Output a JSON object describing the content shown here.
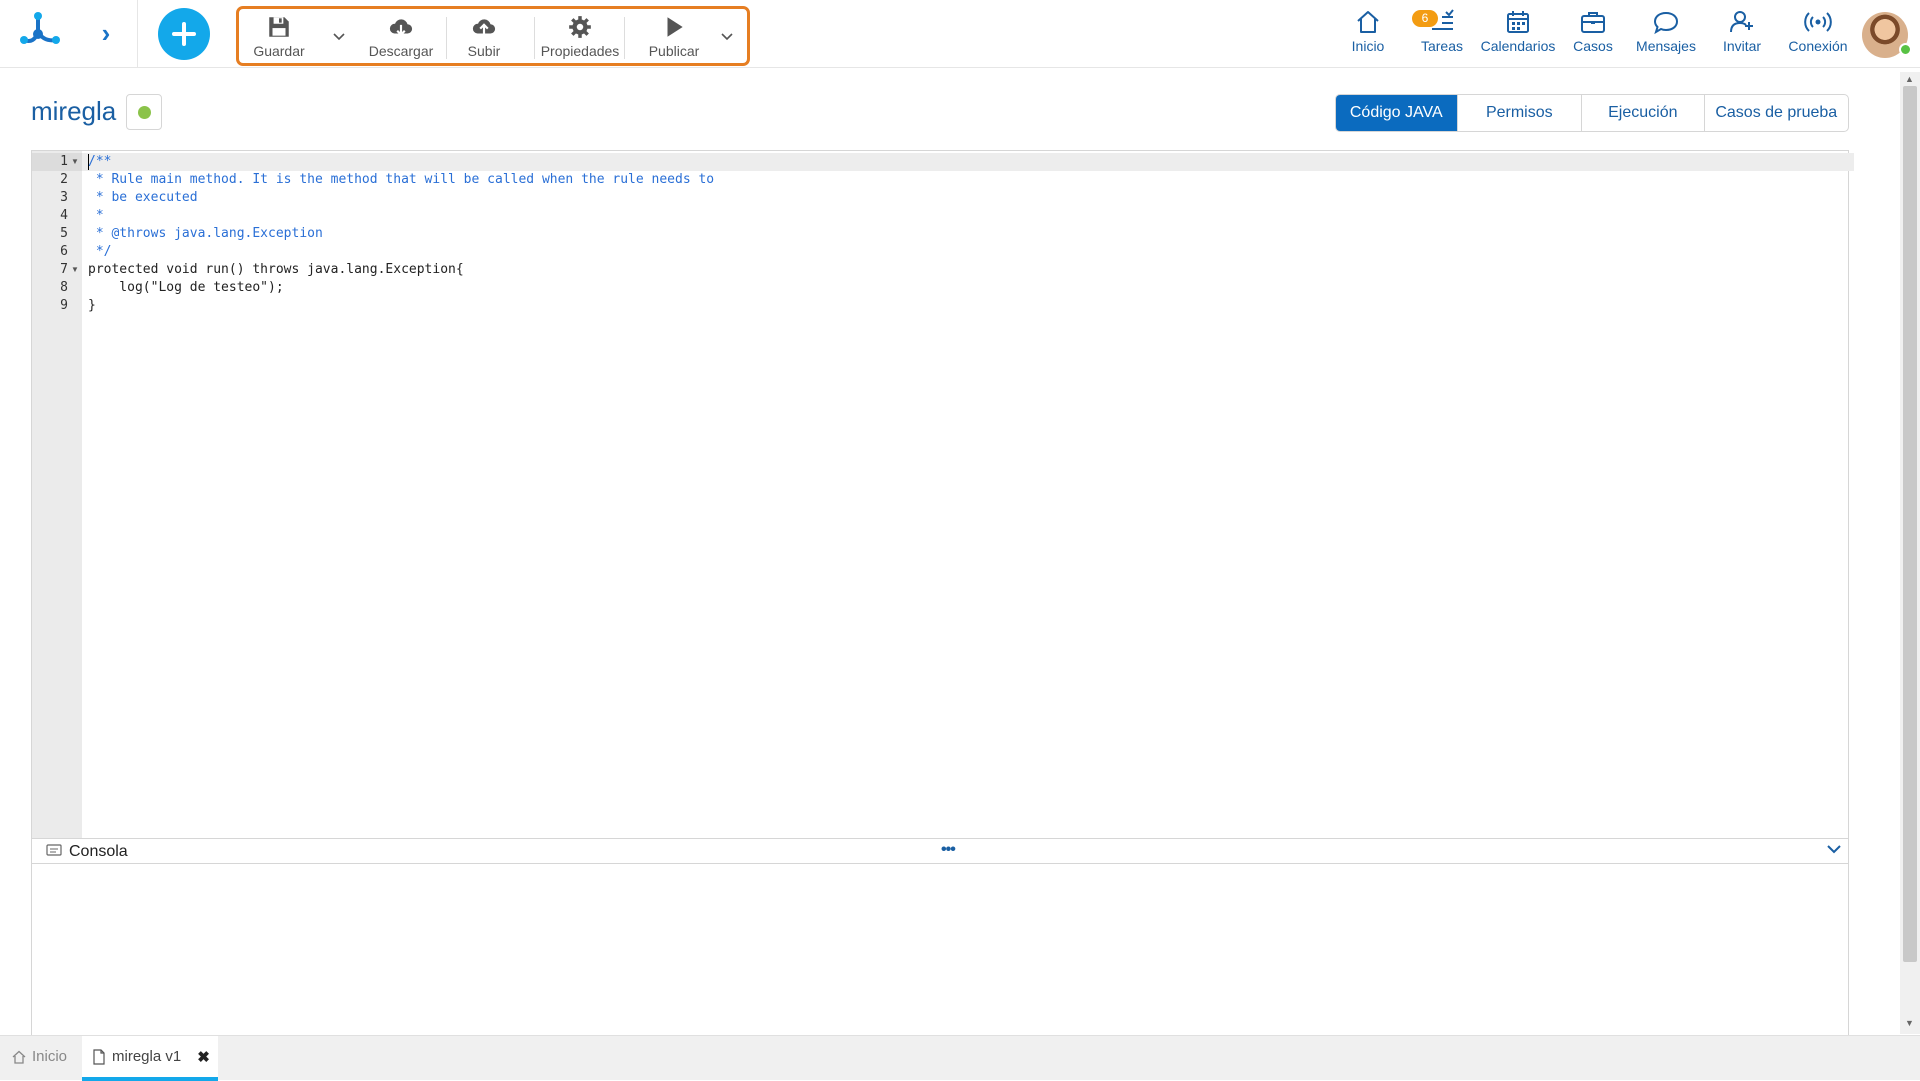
{
  "header": {
    "toolbar": {
      "save_label": "Guardar",
      "download_label": "Descargar",
      "upload_label": "Subir",
      "properties_label": "Propiedades",
      "publish_label": "Publicar"
    },
    "nav": {
      "home_label": "Inicio",
      "tasks_label": "Tareas",
      "tasks_badge": "6",
      "calendars_label": "Calendarios",
      "cases_label": "Casos",
      "messages_label": "Mensajes",
      "invite_label": "Invitar",
      "connection_label": "Conexión"
    },
    "accent_color": "#13a8ea",
    "toolbar_border_color": "#e67e22"
  },
  "page": {
    "title": "miregla",
    "status_color": "#8bc34a"
  },
  "tabs": [
    {
      "label": "Código JAVA",
      "active": true
    },
    {
      "label": "Permisos",
      "active": false
    },
    {
      "label": "Ejecución",
      "active": false
    },
    {
      "label": "Casos de prueba",
      "active": false
    }
  ],
  "editor": {
    "line_numbers": [
      "1",
      "2",
      "3",
      "4",
      "5",
      "6",
      "7",
      "8",
      "9"
    ],
    "lines": [
      "/**",
      " * Rule main method. It is the method that will be called when the rule needs to",
      " * be executed",
      " *",
      " * @throws java.lang.Exception",
      " */",
      "protected void run() throws java.lang.Exception{",
      "    log(\"Log de testeo\");",
      "}"
    ]
  },
  "console": {
    "title": "Consola"
  },
  "taskbar": {
    "home_label": "Inicio",
    "open_tab_label": "miregla v1"
  }
}
